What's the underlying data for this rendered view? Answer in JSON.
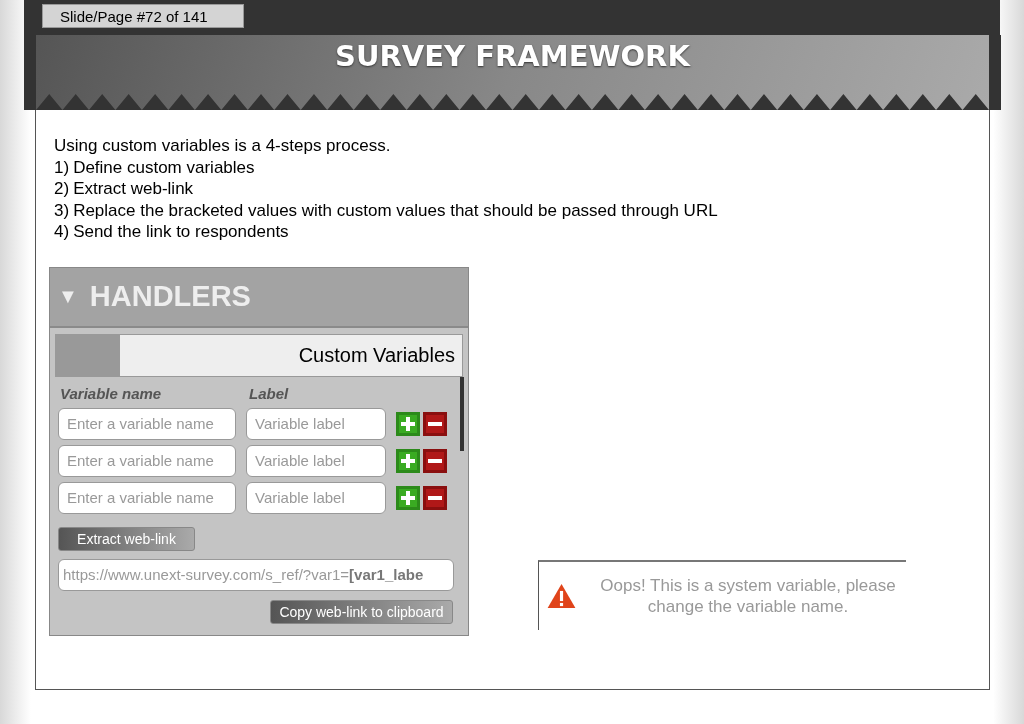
{
  "viewer": {
    "page_label": "Slide/Page #72 of 141"
  },
  "slide": {
    "title": "SURVEY FRAMEWORK",
    "intro": "Using custom variables is a 4-steps process.",
    "steps": [
      {
        "number": "1)",
        "text": "Define custom variables"
      },
      {
        "number": "2)",
        "text": "Extract web-link"
      },
      {
        "number": "3)",
        "text": "Replace the bracketed values with custom values that should be passed through URL"
      },
      {
        "number": "4)",
        "text": "Send the link to respondents"
      }
    ],
    "handlers_panel": {
      "caret": "▼",
      "title": "HANDLERS",
      "tab_label": "Custom Variables",
      "columns": [
        "Variable name",
        "Label"
      ],
      "rows": [
        {
          "name_placeholder": "Enter a variable name",
          "label_placeholder": "Variable label"
        },
        {
          "name_placeholder": "Enter a variable name",
          "label_placeholder": "Variable label"
        },
        {
          "name_placeholder": "Enter a variable name",
          "label_placeholder": "Variable label"
        }
      ],
      "extract_button": "Extract web-link",
      "link_value": "https://www.unext-survey.com/s_ref/?var1=**[var1_labe**",
      "copy_button": "Copy web-link to clipboard"
    },
    "alert": {
      "message": "Oops! This is a system variable, please change the variable name."
    }
  }
}
